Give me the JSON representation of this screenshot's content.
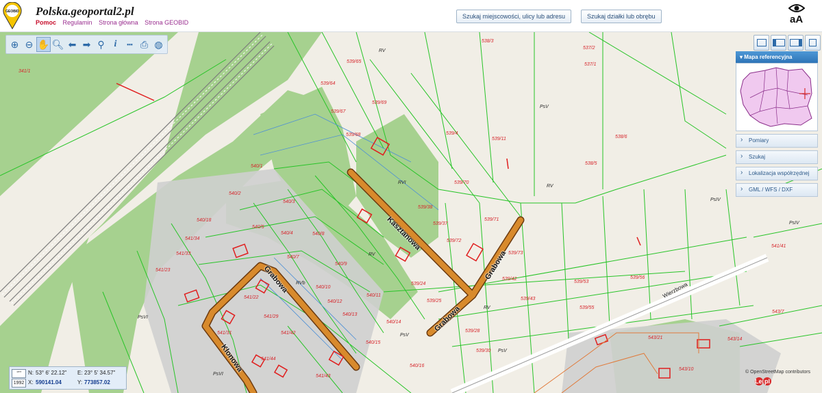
{
  "header": {
    "title": "Polska.geoportal2.pl",
    "logo_text": "GEOBID",
    "links": [
      "Pomoc",
      "Regulamin",
      "Strona główna",
      "Strona GEOBID"
    ],
    "search_place_button": "Szukaj miejscowości, ulicy lub adresu",
    "search_parcel_button": "Szukaj działki lub obrębu",
    "font_size_label": "aA"
  },
  "toolbar": {
    "tools": [
      "zoom-in-icon",
      "zoom-out-icon",
      "pan-hand-icon",
      "zoom-box-icon",
      "back-arrow-icon",
      "forward-arrow-icon",
      "link-icon",
      "info-icon",
      "measure-ruler-icon",
      "print-icon",
      "globe-icon"
    ]
  },
  "side_panel": {
    "ref_map_title": "Mapa referencyjna",
    "items": [
      "Pomiary",
      "Szukaj",
      "Lokalizacja współrzędnej",
      "GML / WFS / DXF"
    ]
  },
  "coords": {
    "system": "1992",
    "n_label": "N:",
    "n_value": "53° 6' 22.12\"",
    "e_label": "E:",
    "e_value": "23° 5' 34.57\"",
    "x_label": "X:",
    "x_value": "590141.04",
    "y_label": "Y:",
    "y_value": "773857.02"
  },
  "map": {
    "streets": [
      "Kasztanowa",
      "Grabowa",
      "Grabowa",
      "Grabowa",
      "Klonowa",
      "Wierzbowa"
    ],
    "parcels": [
      "341/1",
      "538/3",
      "537/2",
      "537/1",
      "539/65",
      "539/64",
      "539/69",
      "539/67",
      "539/68",
      "539/4",
      "539/11",
      "538/6",
      "538/5",
      "539/70",
      "539/71",
      "539/73",
      "539/72",
      "539/37",
      "539/38",
      "539/42",
      "539/43",
      "539/53",
      "539/56",
      "539/55",
      "539/25",
      "539/24",
      "539/28",
      "539/30",
      "540/1",
      "540/2",
      "540/3",
      "540/4",
      "540/5",
      "540/7",
      "540/8",
      "540/9",
      "540/10",
      "540/11",
      "540/12",
      "540/13",
      "540/14",
      "540/15",
      "540/16",
      "540/18",
      "541/34",
      "541/33",
      "541/23",
      "541/22",
      "541/42",
      "541/43",
      "541/44",
      "541/31",
      "541/29",
      "541/41",
      "543/21",
      "543/14",
      "543/10",
      "543/7",
      "543/1"
    ],
    "landuse": [
      "RV",
      "PsV",
      "RVI",
      "RVb",
      "PsVI",
      "PsIV",
      "B",
      "dr"
    ],
    "colors": {
      "background": "#f1eee6",
      "forest": "#9fcb8c",
      "built": "#c9c9c9",
      "parcel_line": "#2dc62d",
      "street_fill": "#d88a2c",
      "building_line": "#e01e1e"
    }
  },
  "attribution": "© OpenStreetMap contributors",
  "watermark": "Lento"
}
